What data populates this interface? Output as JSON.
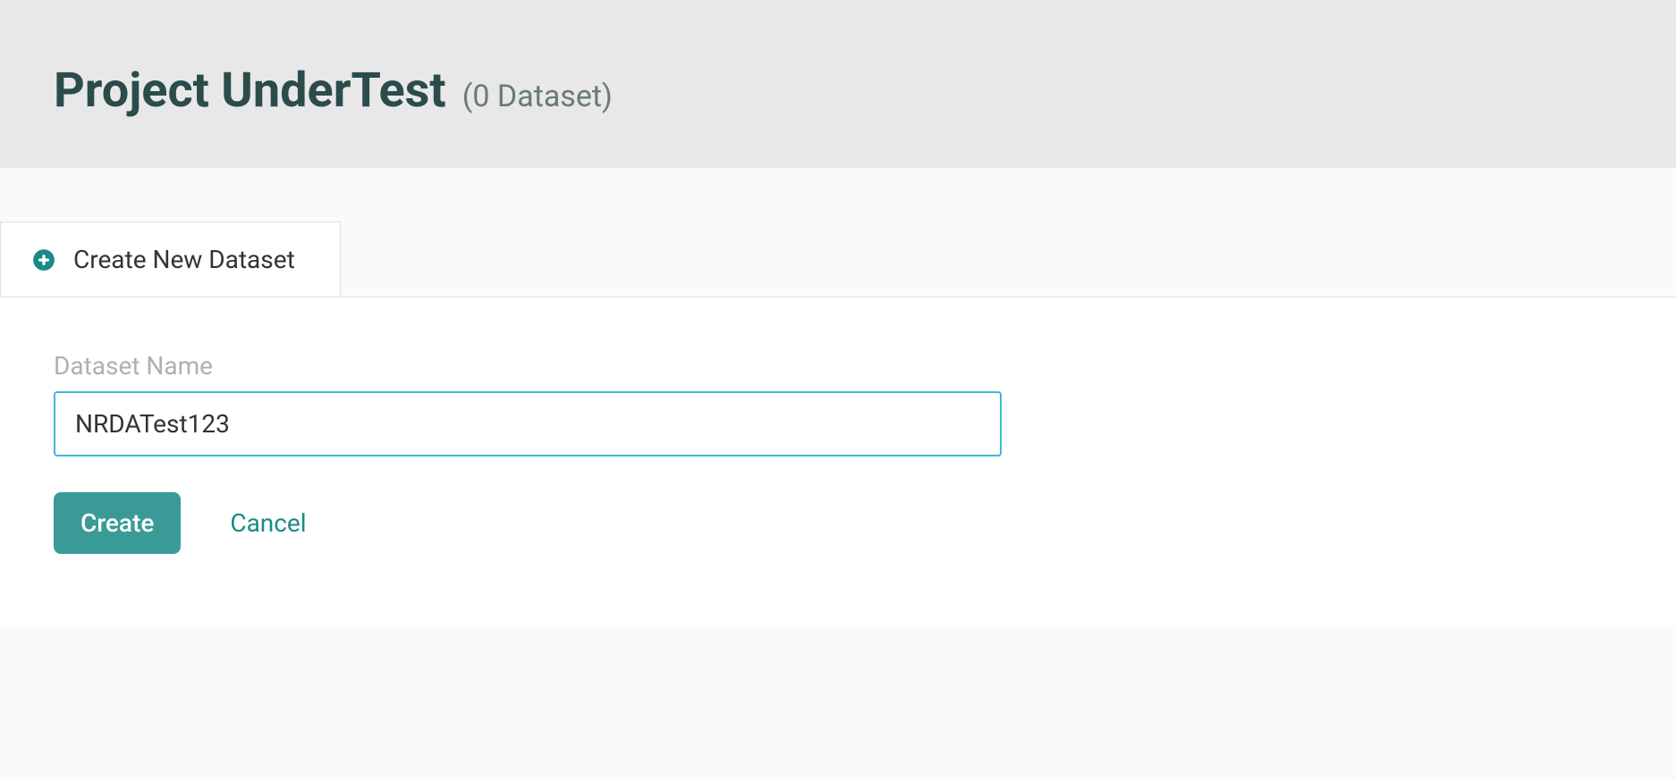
{
  "header": {
    "project_title": "Project UnderTest",
    "dataset_count_text": "(0 Dataset)"
  },
  "tab": {
    "create_label": "Create New Dataset"
  },
  "form": {
    "dataset_name_label": "Dataset Name",
    "dataset_name_value": "NRDATest123",
    "create_button_label": "Create",
    "cancel_button_label": "Cancel"
  },
  "colors": {
    "accent": "#3a9a97",
    "input_border": "#3dbad1"
  }
}
